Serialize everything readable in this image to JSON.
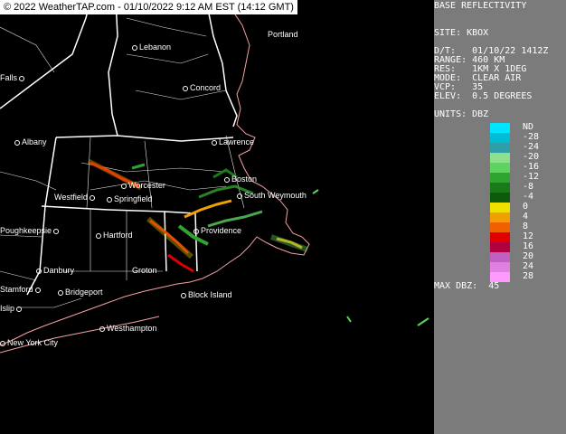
{
  "banner": "© 2022 WeatherTAP.com - 01/10/2022  9:12 AM EST (14:12 GMT)",
  "cities": [
    {
      "name": "Lebanon"
    },
    {
      "name": "Portland"
    },
    {
      "name": "Falls"
    },
    {
      "name": "Concord"
    },
    {
      "name": "Albany"
    },
    {
      "name": "Lawrence"
    },
    {
      "name": "Worcester"
    },
    {
      "name": "Boston"
    },
    {
      "name": "Westfield"
    },
    {
      "name": "Springfield"
    },
    {
      "name": "South Weymouth"
    },
    {
      "name": "Hartford"
    },
    {
      "name": "Providence"
    },
    {
      "name": "Poughkeepsie"
    },
    {
      "name": "Danbury"
    },
    {
      "name": "Groton"
    },
    {
      "name": "Bridgeport"
    },
    {
      "name": "Block Island"
    },
    {
      "name": "Westhampton"
    },
    {
      "name": "New York City"
    },
    {
      "name": "Stamford"
    },
    {
      "name": "Islip"
    }
  ],
  "panel": {
    "title": "BASE REFLECTIVITY",
    "site": "SITE: KBOX",
    "date": "D/T:   01/10/22 1412Z",
    "range": "RANGE: 460 KM",
    "res": "RES:   1KM X 1DEG",
    "mode": "MODE:  CLEAR AIR",
    "vcp": "VCP:   35",
    "elev": "ELEV:  0.5 DEGREES",
    "units": "UNITS: DBZ",
    "max": "MAX DBZ:  45"
  },
  "scale": {
    "labels": [
      "ND",
      "-28",
      "-24",
      "-20",
      "-16",
      "-12",
      "-8",
      "-4",
      "0",
      "4",
      "8",
      "12",
      "16",
      "20",
      "24",
      "28"
    ],
    "colors": [
      "#00e5ff",
      "#00bcd4",
      "#2e9fa8",
      "#8ee08e",
      "#5fd25f",
      "#2fa52f",
      "#1a7a1a",
      "#0d5a0d",
      "#f0e000",
      "#f0a000",
      "#f06000",
      "#e00000",
      "#b00040",
      "#c060c0",
      "#e080e0",
      "#ff99ff"
    ]
  }
}
